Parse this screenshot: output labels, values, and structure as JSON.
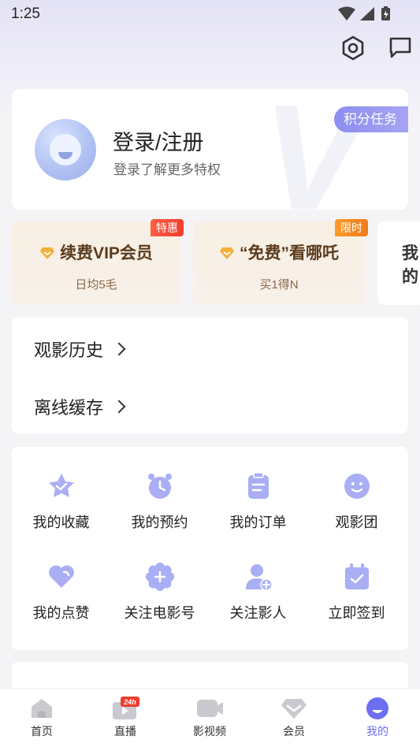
{
  "status_bar": {
    "time": "1:25"
  },
  "top_icons": [
    "settings-icon",
    "message-icon"
  ],
  "profile": {
    "title": "登录/注册",
    "subtitle": "登录了解更多特权",
    "points_tag": "积分任务"
  },
  "promos": [
    {
      "title": "续费VIP会员",
      "subtitle": "日均5毛",
      "tag": "特惠"
    },
    {
      "title": "“免费”看哪吒",
      "subtitle": "买1得N",
      "tag": "限时"
    },
    {
      "title": "我的"
    }
  ],
  "rows": [
    {
      "label": "观影历史"
    },
    {
      "label": "离线缓存"
    }
  ],
  "grid": [
    {
      "label": "我的收藏",
      "icon": "star-icon"
    },
    {
      "label": "我的预约",
      "icon": "alarm-clock-icon"
    },
    {
      "label": "我的订单",
      "icon": "clipboard-icon"
    },
    {
      "label": "观影团",
      "icon": "smile-icon"
    },
    {
      "label": "我的点赞",
      "icon": "heart-icon"
    },
    {
      "label": "关注电影号",
      "icon": "flower-plus-icon"
    },
    {
      "label": "关注影人",
      "icon": "add-user-icon"
    },
    {
      "label": "立即签到",
      "icon": "calendar-check-icon"
    }
  ],
  "tabs": [
    {
      "label": "首页",
      "icon": "home-icon"
    },
    {
      "label": "直播",
      "icon": "live-icon",
      "badge": "24h"
    },
    {
      "label": "影视频",
      "icon": "video-icon"
    },
    {
      "label": "会员",
      "icon": "vip-diamond-icon"
    },
    {
      "label": "我的",
      "icon": "profile-icon",
      "active": true
    }
  ],
  "colors": {
    "accent": "#6b6ff0",
    "icon_purple": "#a9aef5",
    "promo_text": "#5b3b1d",
    "tag_red": "#f03c2e",
    "tag_orange": "#f27a1b"
  }
}
